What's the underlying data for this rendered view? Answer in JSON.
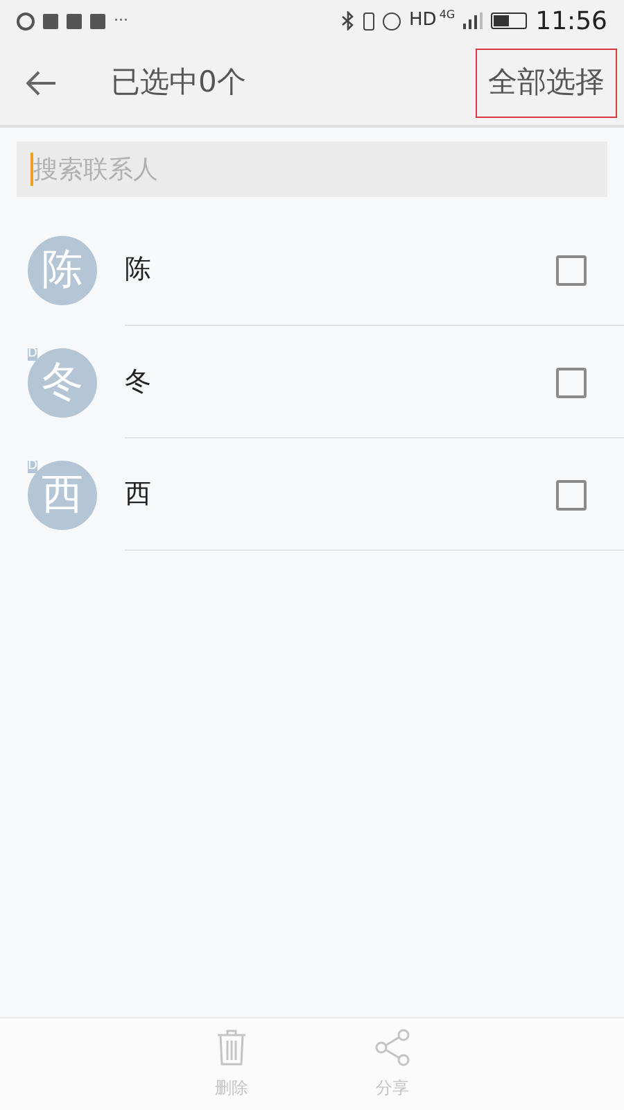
{
  "status_bar": {
    "more": "···",
    "network": "HD",
    "network_type": "4G",
    "time": "11:56"
  },
  "toolbar": {
    "title": "已选中0个",
    "select_all": {
      "label": "全部选择",
      "highlighted": true
    }
  },
  "search": {
    "placeholder": "搜索联系人"
  },
  "contacts": [
    {
      "avatar": "陈",
      "name": "陈",
      "checked": false
    },
    {
      "avatar": "冬",
      "index": "D",
      "name": "冬",
      "checked": false
    },
    {
      "avatar": "西",
      "index": "D",
      "name": "西",
      "checked": false
    }
  ],
  "bottom_bar": [
    {
      "kind": "delete",
      "label": "删除",
      "disabled": true
    },
    {
      "kind": "share",
      "label": "分享",
      "disabled": true
    }
  ]
}
